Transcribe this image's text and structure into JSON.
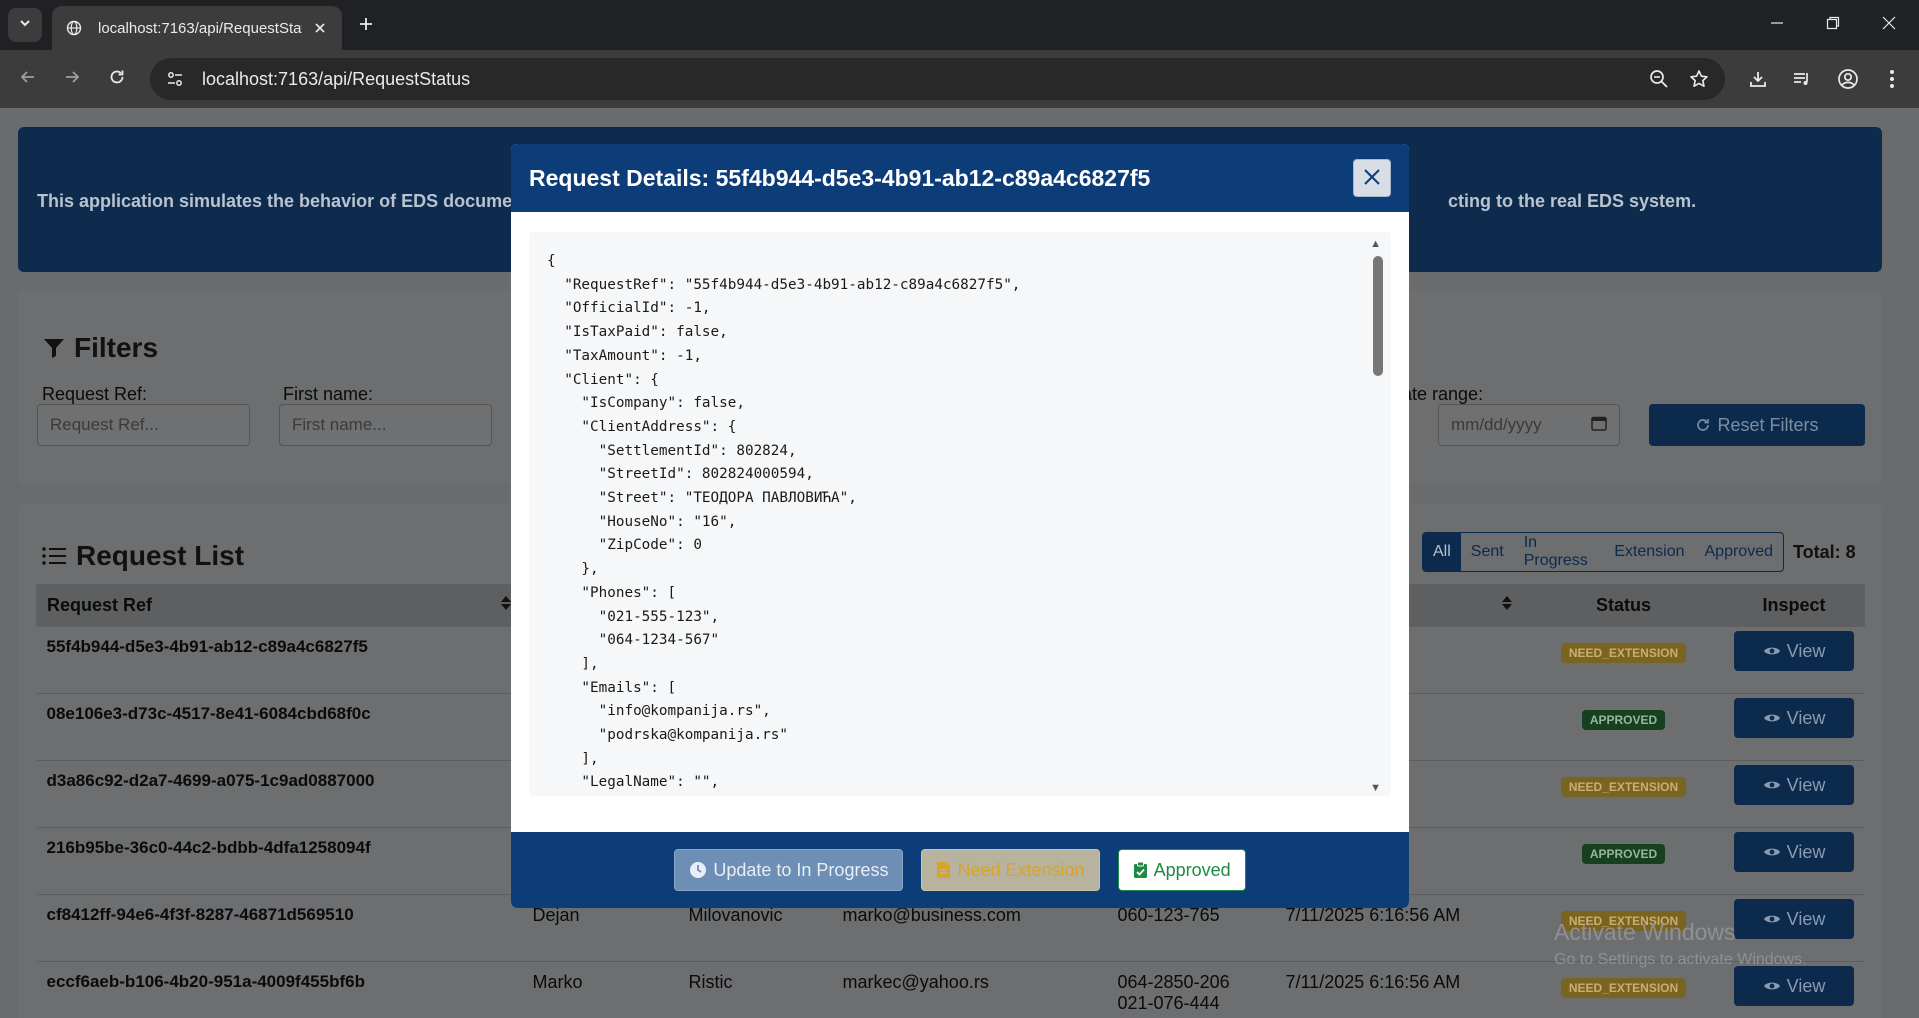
{
  "browser": {
    "tab_title": "localhost:7163/api/RequestStatu",
    "url": "localhost:7163/api/RequestStatus"
  },
  "hero": {
    "text_left": "This application simulates the behavior of EDS document p",
    "text_right": "cting to the real EDS system."
  },
  "filters": {
    "title": "Filters",
    "request_ref_label": "Request Ref:",
    "request_ref_placeholder": "Request Ref...",
    "first_name_label": "First name:",
    "first_name_placeholder": "First name...",
    "date_range_label": "l date range:",
    "date_to_placeholder": "mm/dd/yyyy",
    "reset_label": "Reset Filters"
  },
  "request_list": {
    "title": "Request List",
    "tabs": [
      "All",
      "Sent",
      "In Progress",
      "Extension",
      "Approved"
    ],
    "active_tab": "All",
    "total": "Total: 8",
    "columns": [
      "Request Ref",
      "",
      "",
      "",
      "",
      "",
      "Status",
      "Inspect"
    ],
    "view_label": "View",
    "rows": [
      {
        "ref": "55f4b944-d5e3-4b91-ab12-c89a4c6827f5",
        "first": "",
        "last": "",
        "email": "",
        "phone": "",
        "date": "56 AM",
        "status": "NEED_EXTENSION"
      },
      {
        "ref": "08e106e3-d73c-4517-8e41-6084cbd68f0c",
        "first": "",
        "last": "",
        "email": "",
        "phone": "",
        "date": "56 AM",
        "status": "APPROVED"
      },
      {
        "ref": "d3a86c92-d2a7-4699-a075-1c9ad0887000",
        "first": "",
        "last": "",
        "email": "",
        "phone": "",
        "date": "56 AM",
        "status": "NEED_EXTENSION"
      },
      {
        "ref": "216b95be-36c0-44c2-bdbb-4dfa1258094f",
        "first": "",
        "last": "",
        "email": "",
        "phone": "",
        "date": "56 AM",
        "status": "APPROVED"
      },
      {
        "ref": "cf8412ff-94e6-4f3f-8287-46871d569510",
        "first": "Dejan",
        "last": "Milovanovic",
        "email": "marko@business.com",
        "phone": "060-123-765",
        "date": "7/11/2025 6:16:56 AM",
        "status": "NEED_EXTENSION"
      },
      {
        "ref": "eccf6aeb-b106-4b20-951a-4009f455bf6b",
        "first": "Marko",
        "last": "Ristic",
        "email": "markec@yahoo.rs",
        "phone": "064-2850-206\n021-076-444",
        "date": "7/11/2025 6:16:56 AM",
        "status": "NEED_EXTENSION"
      }
    ]
  },
  "watermark": {
    "line1": "Activate Windows",
    "line2": "Go to Settings to activate Windows."
  },
  "modal": {
    "title": "Request Details: 55f4b944-d5e3-4b91-ab12-c89a4c6827f5",
    "json_text": "{\n  \"RequestRef\": \"55f4b944-d5e3-4b91-ab12-c89a4c6827f5\",\n  \"OfficialId\": -1,\n  \"IsTaxPaid\": false,\n  \"TaxAmount\": -1,\n  \"Client\": {\n    \"IsCompany\": false,\n    \"ClientAddress\": {\n      \"SettlementId\": 802824,\n      \"StreetId\": 802824000594,\n      \"Street\": \"ТЕОДОРА ПАВЛОВИЋА\",\n      \"HouseNo\": \"16\",\n      \"ZipCode\": 0\n    },\n    \"Phones\": [\n      \"021-555-123\",\n      \"064-1234-567\"\n    ],\n    \"Emails\": [\n      \"info@kompanija.rs\",\n      \"podrska@kompanija.rs\"\n    ],\n    \"LegalName\": \"\",",
    "btn_progress": "Update to In Progress",
    "btn_extension": "Need Extension",
    "btn_approved": "Approved"
  }
}
